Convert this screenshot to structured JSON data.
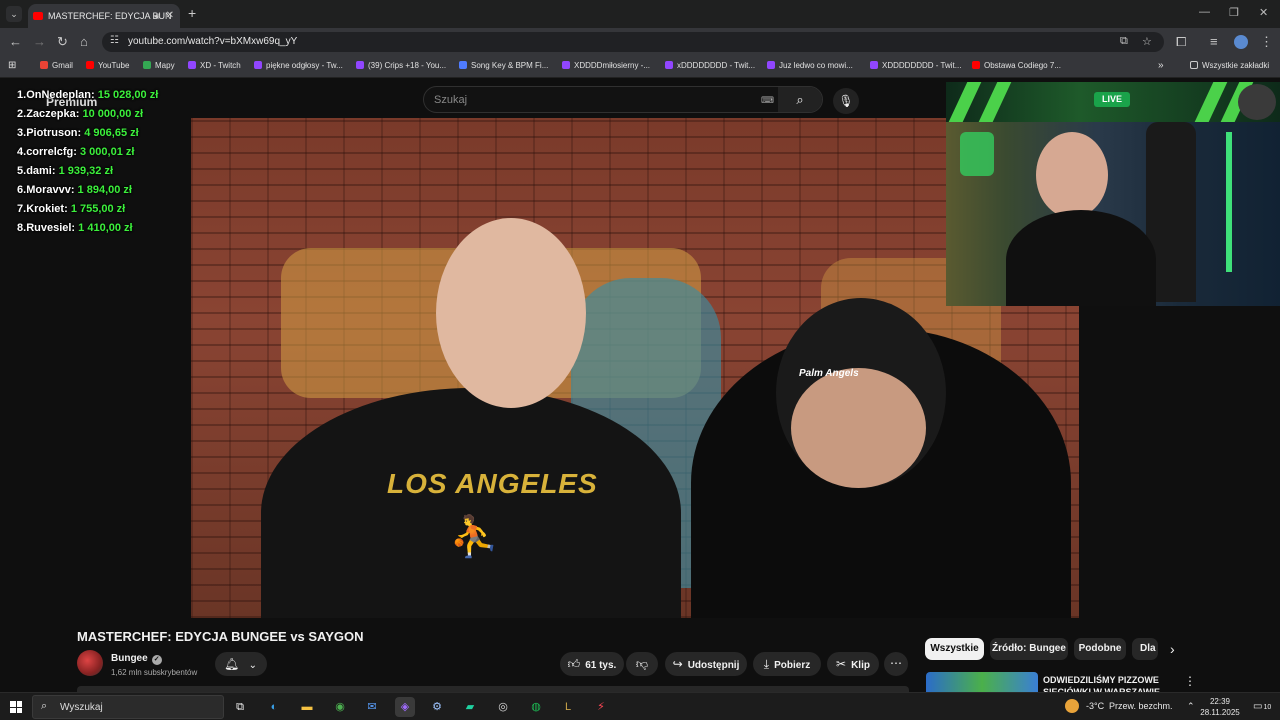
{
  "browser": {
    "tab_title": "MASTERCHEF: EDYCJA BUN",
    "url": "youtube.com/watch?v=bXMxw69q_yY",
    "bookmarks": [
      {
        "label": "Gmail",
        "color": "#ea4335"
      },
      {
        "label": "YouTube",
        "color": "#ff0000"
      },
      {
        "label": "Mapy",
        "color": "#34a853"
      },
      {
        "label": "XD - Twitch",
        "color": "#9146ff"
      },
      {
        "label": "piękne odgłosy - Tw...",
        "color": "#9146ff"
      },
      {
        "label": "(39) Crips +18 - You...",
        "color": "#9146ff"
      },
      {
        "label": "Song Key & BPM Fi...",
        "color": "#4f7cff"
      },
      {
        "label": "XDDDDmiłosierny -...",
        "color": "#9146ff"
      },
      {
        "label": "xDDDDDDDD - Twit...",
        "color": "#9146ff"
      },
      {
        "label": "Juz ledwo co mowi...",
        "color": "#9146ff"
      },
      {
        "label": "XDDDDDDDD - Twit...",
        "color": "#9146ff"
      },
      {
        "label": "Obstawa Codiego 7...",
        "color": "#ff0000"
      }
    ],
    "all_bookmarks": "Wszystkie zakładki"
  },
  "youtube": {
    "logo_text": "Premium",
    "search_placeholder": "Szukaj",
    "video": {
      "title": "MASTERCHEF: EDYCJA BUNGEE vs SAYGON",
      "shirt_text": "LOS ANGELES",
      "cap_text": "Palm Angels"
    },
    "channel": {
      "name": "Bungee",
      "subscribers": "1,62 mln subskrybentów"
    },
    "actions": {
      "likes": "61 tys.",
      "share": "Udostępnij",
      "download": "Pobierz",
      "clip": "Klip"
    },
    "chips": [
      "Wszystkie",
      "Źródło: Bungee",
      "Podobne",
      "Dla"
    ],
    "recommendation": {
      "title": "ODWIEDZILIŚMY PIZZOWE SIECIÓWKI W WARSZAWIE"
    }
  },
  "stream_overlay": {
    "live_badge": "LIVE",
    "leaderboard": [
      {
        "rank": "1.",
        "name": "OnNedeplan:",
        "amount": "15 028,00 zł"
      },
      {
        "rank": "2.",
        "name": "Zaczepka:",
        "amount": "10 000,00 zł"
      },
      {
        "rank": "3.",
        "name": "Piotruson:",
        "amount": "4 906,65 zł"
      },
      {
        "rank": "4.",
        "name": "correlcfg:",
        "amount": "3 000,01 zł"
      },
      {
        "rank": "5.",
        "name": "dami:",
        "amount": "1 939,32 zł"
      },
      {
        "rank": "6.",
        "name": "Moravvv:",
        "amount": "1 894,00 zł"
      },
      {
        "rank": "7.",
        "name": "Krokiet:",
        "amount": "1 755,00 zł"
      },
      {
        "rank": "8.",
        "name": "Ruvesiel:",
        "amount": "1 410,00 zł"
      }
    ]
  },
  "taskbar": {
    "search_text": "Wyszukaj",
    "weather": "-3°C",
    "weather_desc": "Przew. bezchm.",
    "time": "22:39",
    "date": "28.11.2025",
    "notifications": "10"
  }
}
